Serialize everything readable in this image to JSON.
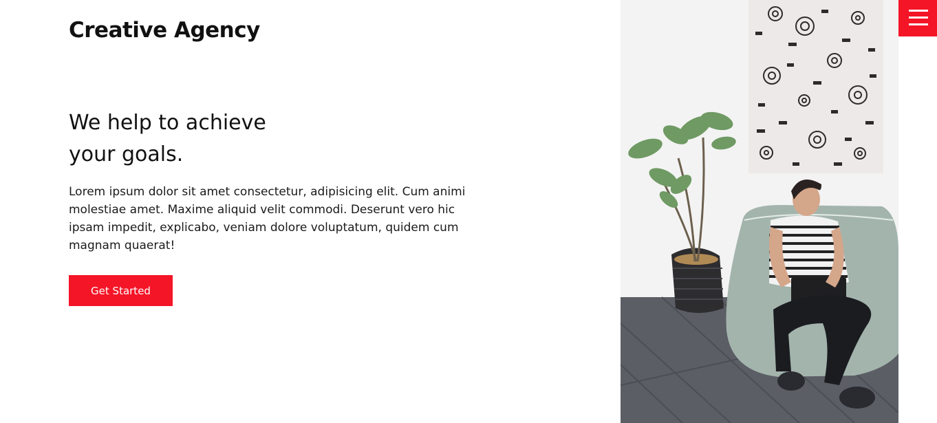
{
  "header": {
    "brand": "Creative Agency",
    "menu_icon": "hamburger-menu-icon"
  },
  "hero": {
    "heading_line1": "We help to achieve",
    "heading_line2": "your goals.",
    "body": "Lorem ipsum dolor sit amet consectetur, adipisicing elit. Cum animi molestiae amet. Maxime aliquid velit commodi. Deserunt vero hic ipsam impedit, explicabo, veniam dolore voluptatum, quidem cum magnam quaerat!",
    "cta_label": "Get Started",
    "image_alt": "Man with laptop sitting on a bean bag next to a potted plant"
  },
  "colors": {
    "accent": "#f41527",
    "text": "#111111",
    "background": "#ffffff"
  }
}
